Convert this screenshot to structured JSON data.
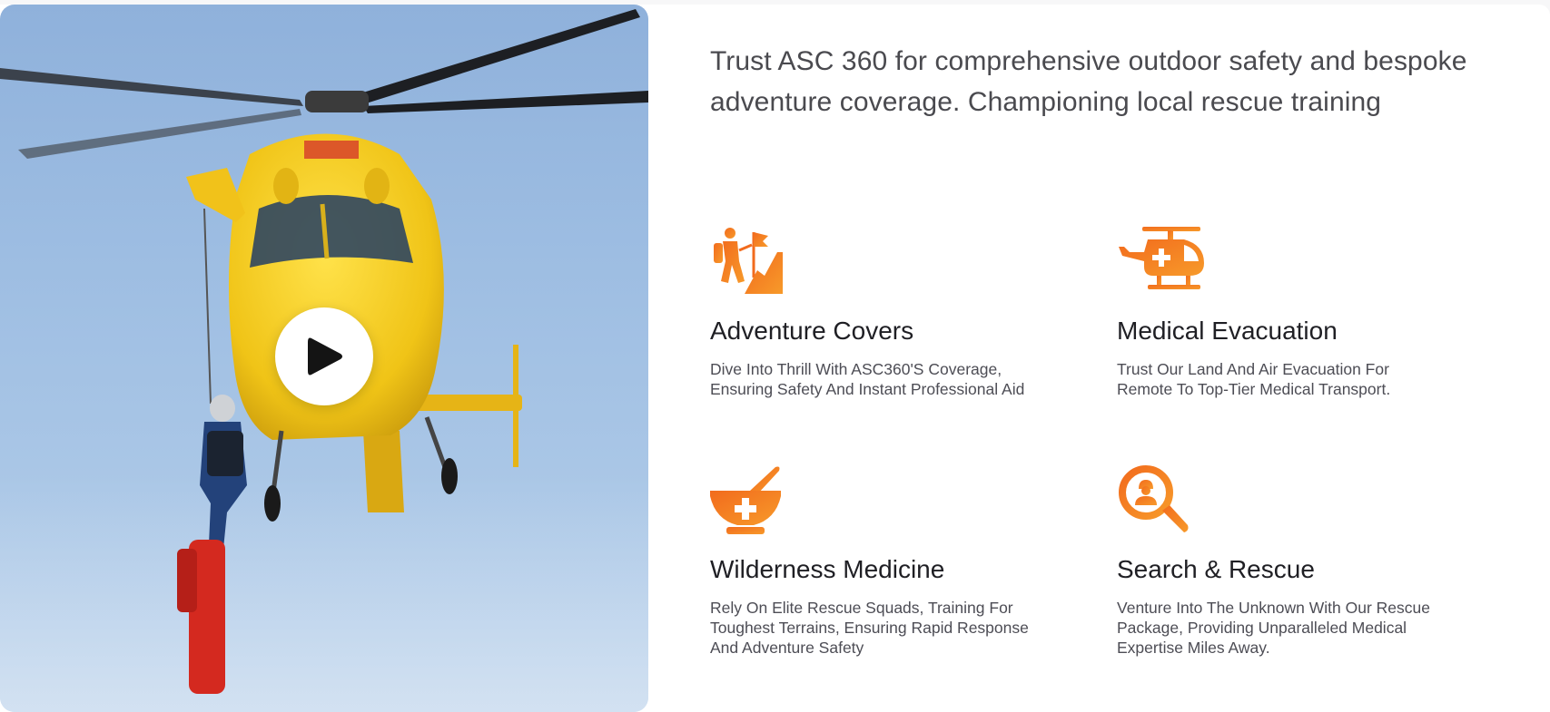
{
  "media": {
    "play_icon": "play-icon",
    "image_subject": "helicopter-rescue-photo"
  },
  "headline": "Trust ASC 360 for comprehensive outdoor safety and bespoke adventure coverage. Championing local rescue training",
  "features": [
    {
      "icon": "hiker-flag-icon",
      "title": "Adventure Covers",
      "desc_line1": "Dive Into Thrill With ASC360'S Coverage,",
      "desc_line2": "Ensuring Safety And Instant Professional Aid"
    },
    {
      "icon": "medical-helicopter-icon",
      "title": "Medical Evacuation",
      "desc_line1": "Trust Our Land And Air Evacuation For",
      "desc_line2": "Remote To Top-Tier Medical Transport."
    },
    {
      "icon": "mortar-pestle-cross-icon",
      "title": "Wilderness Medicine",
      "desc_line1": "Rely On Elite Rescue Squads, Training For",
      "desc_line2": "Toughest Terrains, Ensuring Rapid Response",
      "desc_line3": "And Adventure Safety"
    },
    {
      "icon": "search-rescuer-icon",
      "title": "Search & Rescue",
      "desc_line1": "Venture Into The Unknown With Our Rescue",
      "desc_line2": "Package, Providing Unparalleled Medical",
      "desc_line3": "Expertise Miles Away."
    }
  ],
  "colors": {
    "accent_orange": "#f26b1d",
    "accent_orange_light": "#f7941d",
    "heading": "#1f1f24",
    "body_text": "#4d4d55"
  }
}
